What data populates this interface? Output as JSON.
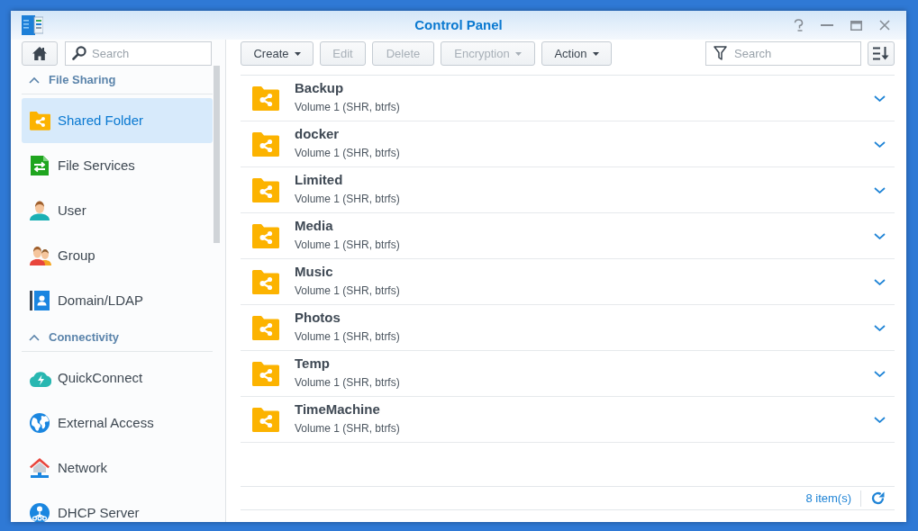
{
  "window": {
    "title": "Control Panel"
  },
  "sidebar": {
    "search": {
      "placeholder": "Search"
    },
    "sections": [
      {
        "title": "File Sharing",
        "expanded": true,
        "items": [
          {
            "label": "Shared Folder",
            "selected": true
          },
          {
            "label": "File Services",
            "selected": false
          },
          {
            "label": "User",
            "selected": false
          },
          {
            "label": "Group",
            "selected": false
          },
          {
            "label": "Domain/LDAP",
            "selected": false
          }
        ]
      },
      {
        "title": "Connectivity",
        "expanded": true,
        "items": [
          {
            "label": "QuickConnect",
            "selected": false
          },
          {
            "label": "External Access",
            "selected": false
          },
          {
            "label": "Network",
            "selected": false
          },
          {
            "label": "DHCP Server",
            "selected": false
          }
        ]
      }
    ]
  },
  "toolbar": {
    "buttons": [
      {
        "label": "Create",
        "disabled": false,
        "has_menu": true
      },
      {
        "label": "Edit",
        "disabled": true,
        "has_menu": false
      },
      {
        "label": "Delete",
        "disabled": true,
        "has_menu": false
      },
      {
        "label": "Encryption",
        "disabled": true,
        "has_menu": true
      },
      {
        "label": "Action",
        "disabled": false,
        "has_menu": true
      }
    ],
    "search": {
      "placeholder": "Search"
    }
  },
  "folders": [
    {
      "name": "Backup",
      "location": "Volume 1 (SHR, btrfs)",
      "expanded": false
    },
    {
      "name": "docker",
      "location": "Volume 1 (SHR, btrfs)",
      "expanded": false
    },
    {
      "name": "Limited",
      "location": "Volume 1 (SHR, btrfs)",
      "expanded": false
    },
    {
      "name": "Media",
      "location": "Volume 1 (SHR, btrfs)",
      "expanded": false
    },
    {
      "name": "Music",
      "location": "Volume 1 (SHR, btrfs)",
      "expanded": false
    },
    {
      "name": "Photos",
      "location": "Volume 1 (SHR, btrfs)",
      "expanded": false
    },
    {
      "name": "Temp",
      "location": "Volume 1 (SHR, btrfs)",
      "expanded": false
    },
    {
      "name": "TimeMachine",
      "location": "Volume 1 (SHR, btrfs)",
      "expanded": false
    }
  ],
  "status_bar": {
    "count": "8 item(s)"
  }
}
